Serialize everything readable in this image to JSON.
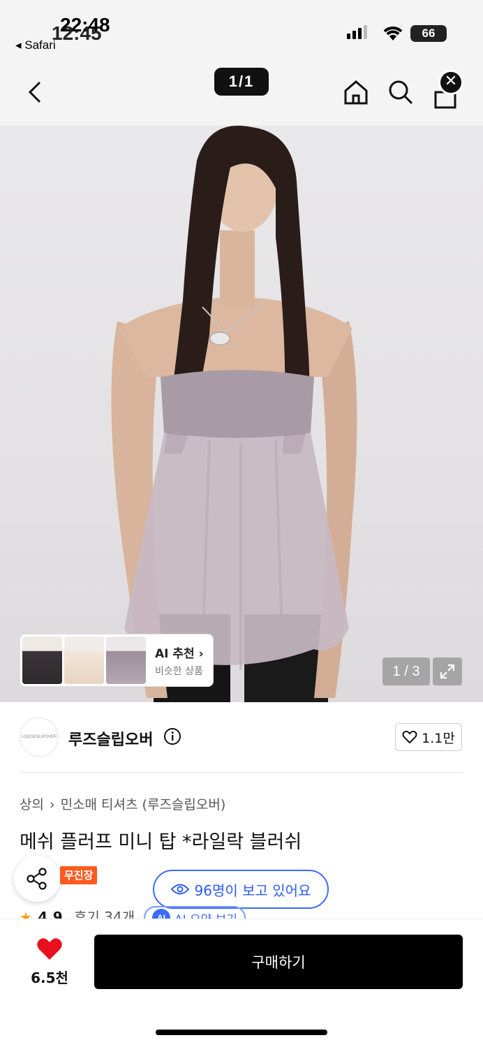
{
  "status_bar": {
    "time_primary": "22:48",
    "time_secondary": "12:45",
    "back_app": "Safari",
    "battery": "66"
  },
  "nav": {
    "image_counter": "1/1",
    "icons": [
      "back-icon",
      "home-icon",
      "search-icon",
      "cart-icon",
      "close-icon"
    ]
  },
  "gallery": {
    "ai_title": "AI 추천",
    "ai_subtitle": "비슷한 상품",
    "page_indicator": "1 / 3"
  },
  "brand": {
    "logo_text": "LOOSESLIPOVER",
    "name": "루즈슬립오버",
    "likes": "1.1만"
  },
  "product": {
    "breadcrumb": [
      "상의",
      "민소매 티셔츠 (루즈슬립오버)"
    ],
    "title": "메쉬 플러프 미니 탑 *라일락 블러쉬",
    "badge": "무진장",
    "viewers": "96명이 보고 있어요",
    "rating": "4.9",
    "reviews": "후기 34개",
    "ai_summary": "AI 요약 보기"
  },
  "bottom_bar": {
    "heart_count": "6.5천",
    "buy_label": "구매하기"
  },
  "colors": {
    "accent_blue": "#3b6bff",
    "badge_orange": "#ff5a1f",
    "heart_red": "#e8101c",
    "star_gold": "#f5a400"
  }
}
